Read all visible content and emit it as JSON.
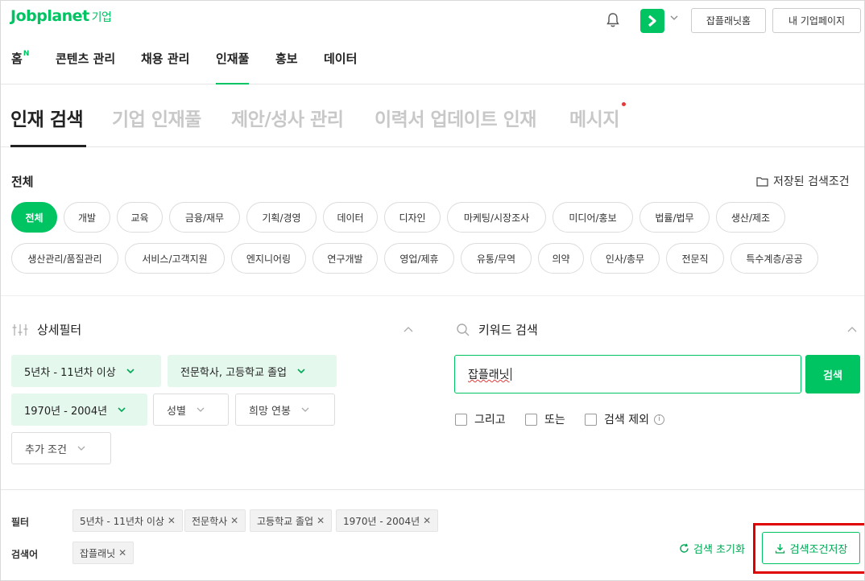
{
  "brand": {
    "name": "Jobplanet",
    "suffix": "기업"
  },
  "header": {
    "home_button": "잡플래닛홈",
    "my_page_button": "내 기업페이지",
    "colors": {
      "accent": "#00c362"
    }
  },
  "main_nav": {
    "items": [
      {
        "label": "홈",
        "badge": "N"
      },
      {
        "label": "콘텐츠 관리"
      },
      {
        "label": "채용 관리"
      },
      {
        "label": "인재풀",
        "active": true
      },
      {
        "label": "홍보"
      },
      {
        "label": "데이터"
      }
    ]
  },
  "sub_tabs": [
    "인재 검색",
    "기업 인재풀",
    "제안/성사 관리",
    "이력서 업데이트 인재",
    "메시지"
  ],
  "category": {
    "title": "전체",
    "saved_label": "저장된 검색조건",
    "chips": [
      "전체",
      "개발",
      "교육",
      "금융/재무",
      "기획/경영",
      "데이터",
      "디자인",
      "마케팅/시장조사",
      "미디어/홍보",
      "법률/법무",
      "생산/제조",
      "생산관리/품질관리",
      "서비스/고객지원",
      "엔지니어링",
      "연구개발",
      "영업/제휴",
      "유통/무역",
      "의약",
      "인사/총무",
      "전문직",
      "특수계층/공공"
    ]
  },
  "detail_filter": {
    "title": "상세필터",
    "experience": "5년차 - 11년차 이상",
    "education": "전문학사, 고등학교 졸업",
    "birth_year": "1970년 - 2004년",
    "gender": "성별",
    "salary": "희망 연봉",
    "extra": "추가 조건"
  },
  "keyword": {
    "title": "키워드 검색",
    "value": "잡플래닛",
    "search_button": "검색",
    "options": [
      "그리고",
      "또는",
      "검색 제외"
    ]
  },
  "applied": {
    "filter_label": "필터",
    "filter_tags": [
      "5년차 - 11년차 이상",
      "전문학사",
      "고등학교 졸업",
      "1970년 - 2004년"
    ],
    "keyword_label": "검색어",
    "keyword_tags": [
      "잡플래닛"
    ],
    "reset_label": "검색 초기화",
    "save_label": "검색조건저장"
  }
}
